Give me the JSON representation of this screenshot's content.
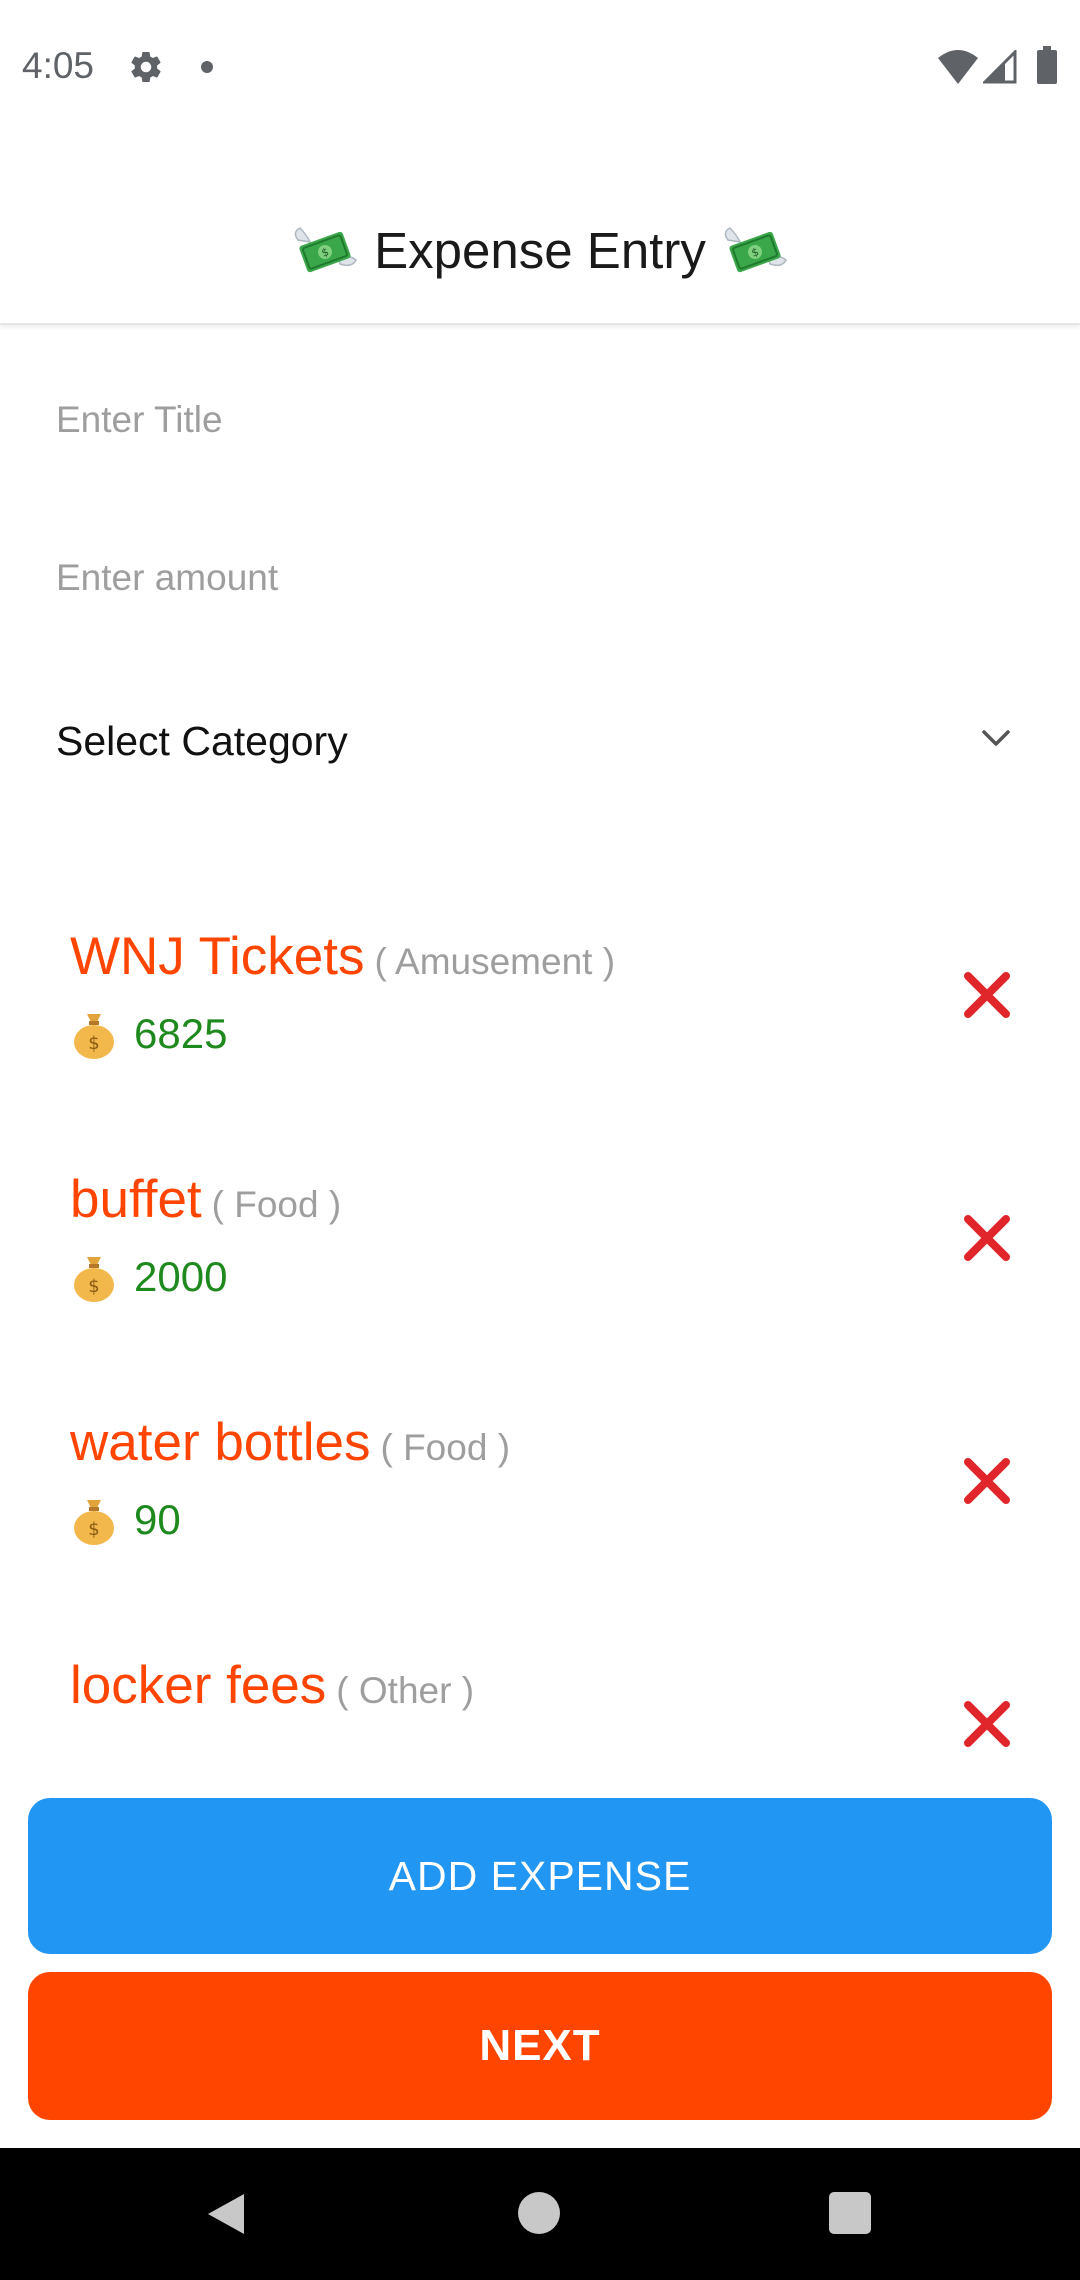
{
  "status_bar": {
    "time": "4:05"
  },
  "header": {
    "title": "Expense Entry",
    "left_icon": "money-with-wings-icon",
    "right_icon": "money-with-wings-icon"
  },
  "form": {
    "title_placeholder": "Enter Title",
    "title_value": "",
    "amount_placeholder": "Enter amount",
    "amount_value": "",
    "category_label": "Select Category"
  },
  "expenses": [
    {
      "title": "WNJ Tickets",
      "category": "( Amusement )",
      "amount": "6825"
    },
    {
      "title": "buffet",
      "category": "( Food )",
      "amount": "2000"
    },
    {
      "title": "water bottles",
      "category": "( Food )",
      "amount": "90"
    },
    {
      "title": "locker fees",
      "category": "( Other )",
      "amount": ""
    }
  ],
  "buttons": {
    "add_expense": "ADD EXPENSE",
    "next": "NEXT"
  },
  "colors": {
    "accent_orange": "#ff4500",
    "primary_blue": "#2196f3",
    "amount_green": "#1e8a1e",
    "delete_red": "#e0262b"
  }
}
